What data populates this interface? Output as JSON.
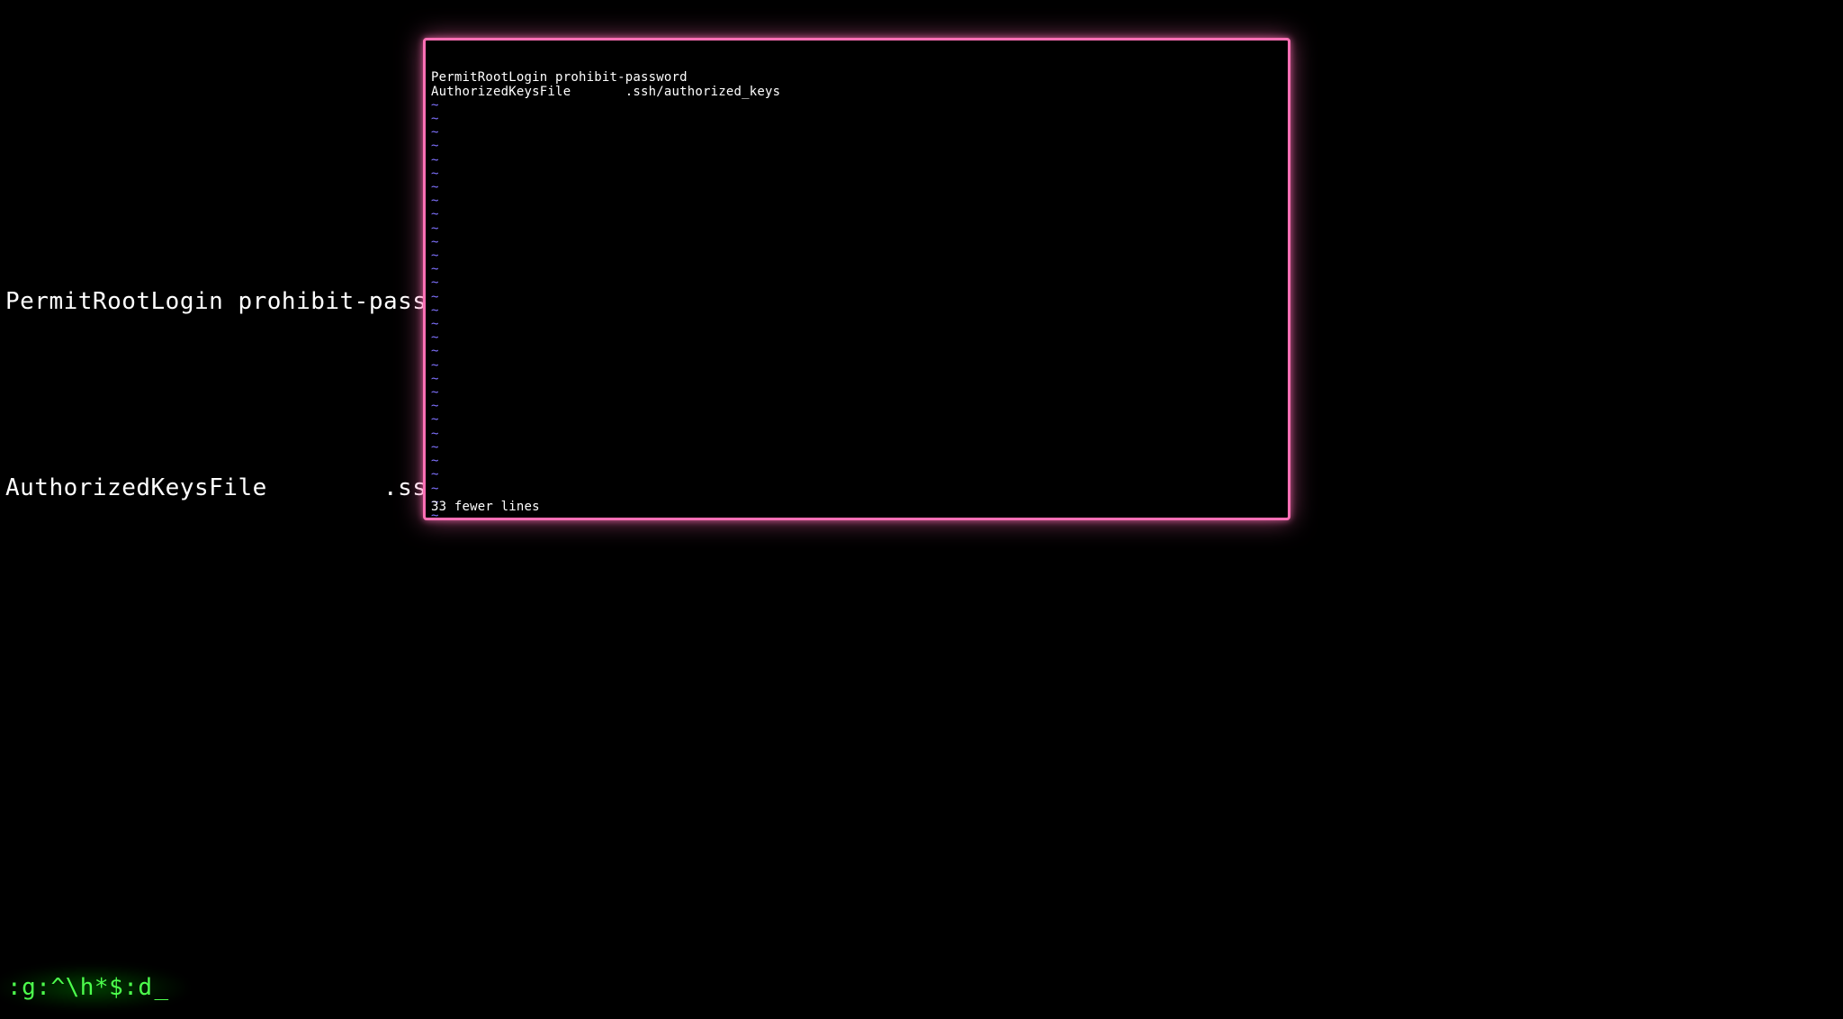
{
  "background": {
    "line1": "PermitRootLogin prohibit-password",
    "line2": "AuthorizedKeysFile        .ssh/authorized_keys"
  },
  "command": {
    "text": ":g:^\\h*$:d",
    "cursor": "_"
  },
  "overlay": {
    "file_lines": [
      "PermitRootLogin prohibit-password",
      "AuthorizedKeysFile       .ssh/authorized_keys"
    ],
    "tilde": "~",
    "tilde_count": 31,
    "status": "33 fewer lines"
  },
  "colors": {
    "background": "#000000",
    "text": "#ffffff",
    "command_green": "#4dff4d",
    "overlay_border": "#ff6fb5",
    "tilde_blue": "#7f72ff"
  }
}
